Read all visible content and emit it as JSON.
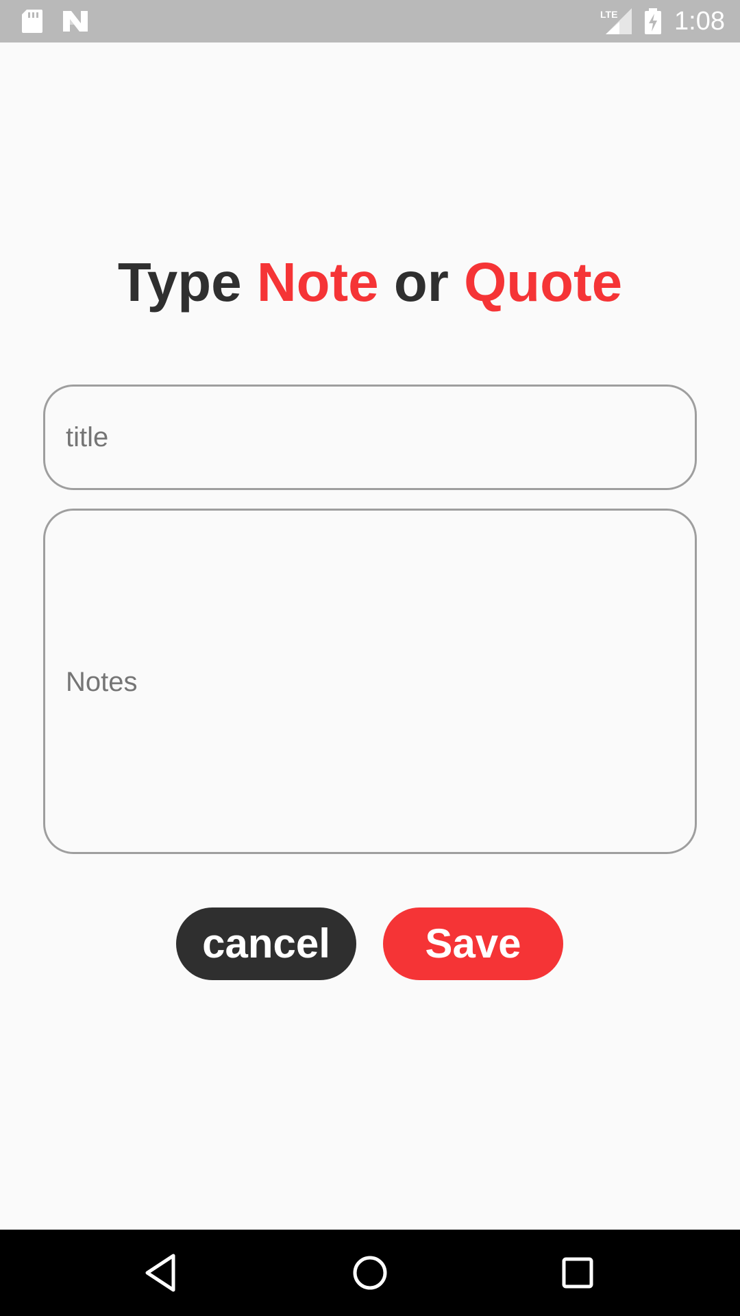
{
  "status_bar": {
    "time": "1:08",
    "network_label": "LTE",
    "icons": [
      "sd-card-icon",
      "n-logo-icon",
      "lte-signal-icon",
      "battery-charging-icon"
    ]
  },
  "heading": {
    "part1": "Type ",
    "note": "Note",
    "part2": " or ",
    "quote": "Quote"
  },
  "form": {
    "title_placeholder": "title",
    "notes_placeholder": "Notes"
  },
  "buttons": {
    "cancel_label": "cancel",
    "save_label": "Save"
  },
  "nav_bar": {
    "icons": [
      "back-icon",
      "home-icon",
      "recents-icon"
    ]
  },
  "colors": {
    "accent": "#f53436",
    "dark": "#2f2f2f",
    "background": "#fafafa",
    "status_bar": "#b9b9b9",
    "border": "#9e9e9e"
  }
}
